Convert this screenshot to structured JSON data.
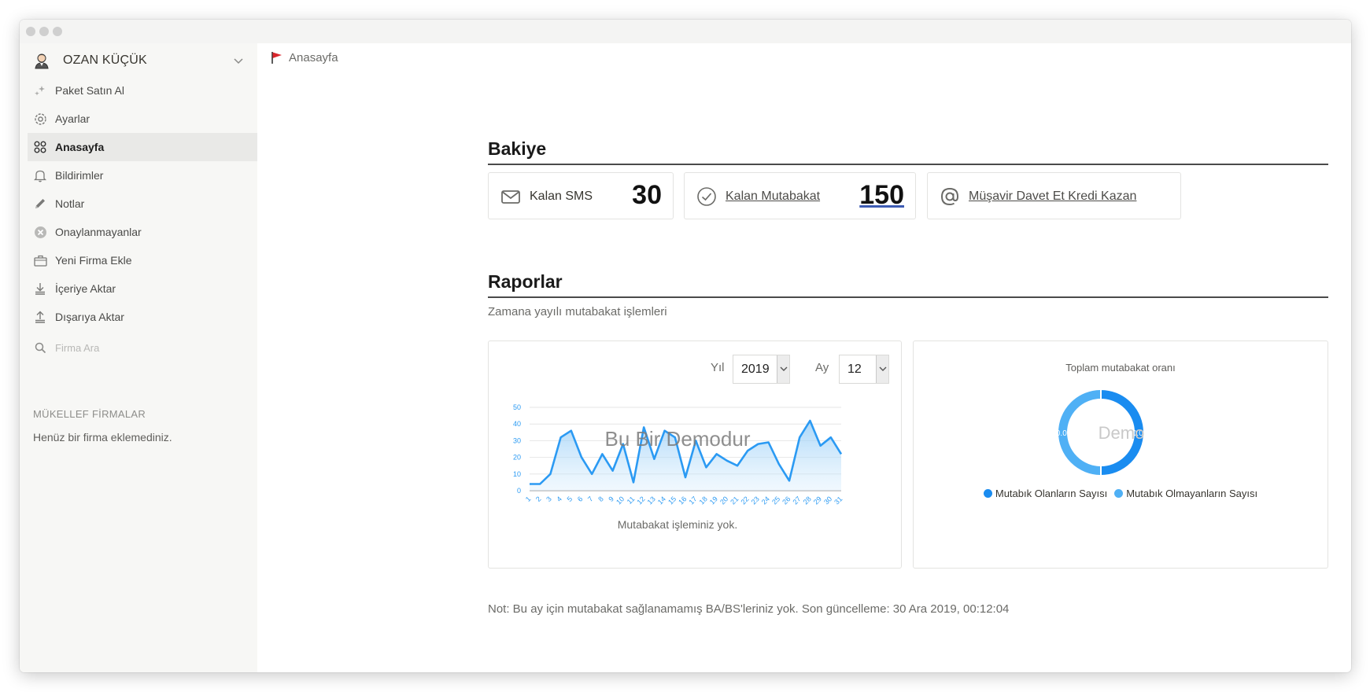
{
  "user": {
    "name": "OZAN KÜÇÜK",
    "avatar_icon": "user-avatar-icon"
  },
  "sidebar": {
    "items": [
      {
        "label": "Paket Satın Al",
        "icon": "sparkle-icon"
      },
      {
        "label": "Ayarlar",
        "icon": "gear-icon"
      },
      {
        "label": "Anasayfa",
        "icon": "grid-icon",
        "active": true
      },
      {
        "label": "Bildirimler",
        "icon": "bell-icon"
      },
      {
        "label": "Notlar",
        "icon": "pencil-icon"
      },
      {
        "label": "Onaylanmayanlar",
        "icon": "x-circle-icon"
      },
      {
        "label": "Yeni Firma Ekle",
        "icon": "briefcase-icon"
      },
      {
        "label": "İçeriye Aktar",
        "icon": "download-icon"
      },
      {
        "label": "Dışarıya Aktar",
        "icon": "upload-icon"
      }
    ],
    "search_placeholder": "Firma Ara",
    "section_title": "MÜKELLEF FİRMALAR",
    "empty_text": "Henüz bir firma eklemediniz."
  },
  "breadcrumb": {
    "label": "Anasayfa"
  },
  "balance": {
    "title": "Bakiye",
    "sms_label": "Kalan SMS",
    "sms_value": "30",
    "reconciliation_label": "Kalan Mutabakat",
    "reconciliation_value": "150",
    "invite_label": "Müşavir Davet Et Kredi Kazan"
  },
  "reports": {
    "title": "Raporlar",
    "subtitle": "Zamana yayılı mutabakat işlemleri",
    "year_label": "Yıl",
    "year_value": "2019",
    "month_label": "Ay",
    "month_value": "12",
    "watermark": "Bu Bir Demodur",
    "empty_note": "Mutabakat işleminiz yok.",
    "pie_title": "Toplam mutabakat oranı",
    "pie_watermark": "Demo"
  },
  "footer_note": "Not: Bu ay için mutabakat sağlanamamış BA/BS'leriniz yok. Son güncelleme: 30 Ara 2019, 00:12:04",
  "colors": {
    "accent": "#2b9af3",
    "accent_light": "#4fb0f5",
    "pie_dark": "#1a8cf0"
  },
  "chart_data": [
    {
      "type": "area",
      "title": "",
      "xlabel": "",
      "ylabel": "",
      "ylim": [
        0,
        50
      ],
      "yticks": [
        0,
        10,
        20,
        30,
        40,
        50
      ],
      "grid": true,
      "categories": [
        "1",
        "2",
        "3",
        "4",
        "5",
        "6",
        "7",
        "8",
        "9",
        "10",
        "11",
        "12",
        "13",
        "14",
        "15",
        "16",
        "17",
        "18",
        "19",
        "20",
        "21",
        "22",
        "23",
        "24",
        "25",
        "26",
        "27",
        "28",
        "29",
        "30",
        "31"
      ],
      "values": [
        4,
        4,
        10,
        32,
        36,
        20,
        10,
        22,
        12,
        28,
        5,
        38,
        19,
        36,
        32,
        8,
        30,
        14,
        22,
        18,
        15,
        24,
        28,
        29,
        16,
        6,
        32,
        42,
        27,
        32,
        22
      ]
    },
    {
      "type": "pie",
      "title": "Toplam mutabakat oranı",
      "legend": "bottom",
      "slices": [
        {
          "name": "Mutabık Olanların Sayısı",
          "value": 50.0,
          "label": "50.0%",
          "color": "#1a8cf0"
        },
        {
          "name": "Mutabık Olmayanların Sayısı",
          "value": 50.0,
          "label": "50.0%",
          "color": "#4fb0f5"
        }
      ]
    }
  ]
}
